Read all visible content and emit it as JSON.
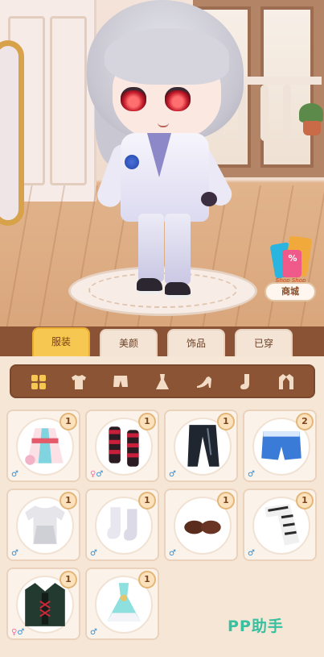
{
  "scene": {
    "shop": {
      "label": "商城",
      "tag": "Shop Shop",
      "percent": "%"
    }
  },
  "tabs": [
    {
      "label": "服装",
      "active": true
    },
    {
      "label": "美颜",
      "active": false
    },
    {
      "label": "饰品",
      "active": false
    },
    {
      "label": "已穿",
      "active": false
    }
  ],
  "categories": [
    {
      "icon": "grid-icon",
      "active": true
    },
    {
      "icon": "tshirt-icon"
    },
    {
      "icon": "shorts-icon"
    },
    {
      "icon": "dress-icon"
    },
    {
      "icon": "high-heel-icon"
    },
    {
      "icon": "sock-icon"
    },
    {
      "icon": "jacket-icon"
    }
  ],
  "items": [
    {
      "icon": "kimono-outfit-icon",
      "count": "1",
      "gender": "♂"
    },
    {
      "icon": "striped-leg-warmers-icon",
      "count": "1",
      "gender": "♀♂"
    },
    {
      "icon": "black-pants-icon",
      "count": "1",
      "gender": "♂"
    },
    {
      "icon": "blue-shorts-icon",
      "count": "2",
      "gender": "♂"
    },
    {
      "icon": "white-tunic-icon",
      "count": "1",
      "gender": "♂"
    },
    {
      "icon": "white-socks-icon",
      "count": "1",
      "gender": "♂"
    },
    {
      "icon": "brown-shoes-icon",
      "count": "1",
      "gender": "♂"
    },
    {
      "icon": "striped-scarf-icon",
      "count": "1",
      "gender": "♂"
    },
    {
      "icon": "dark-coat-icon",
      "count": "1",
      "gender": "♀♂"
    },
    {
      "icon": "mint-dress-icon",
      "count": "1",
      "gender": "♂"
    }
  ],
  "watermark": "PP助手",
  "colors": {
    "tab_active": "#f7c851",
    "panel": "#f5e6d6",
    "frame": "#8a5335",
    "male": "#2f8fd8",
    "female": "#ff6aa8"
  }
}
